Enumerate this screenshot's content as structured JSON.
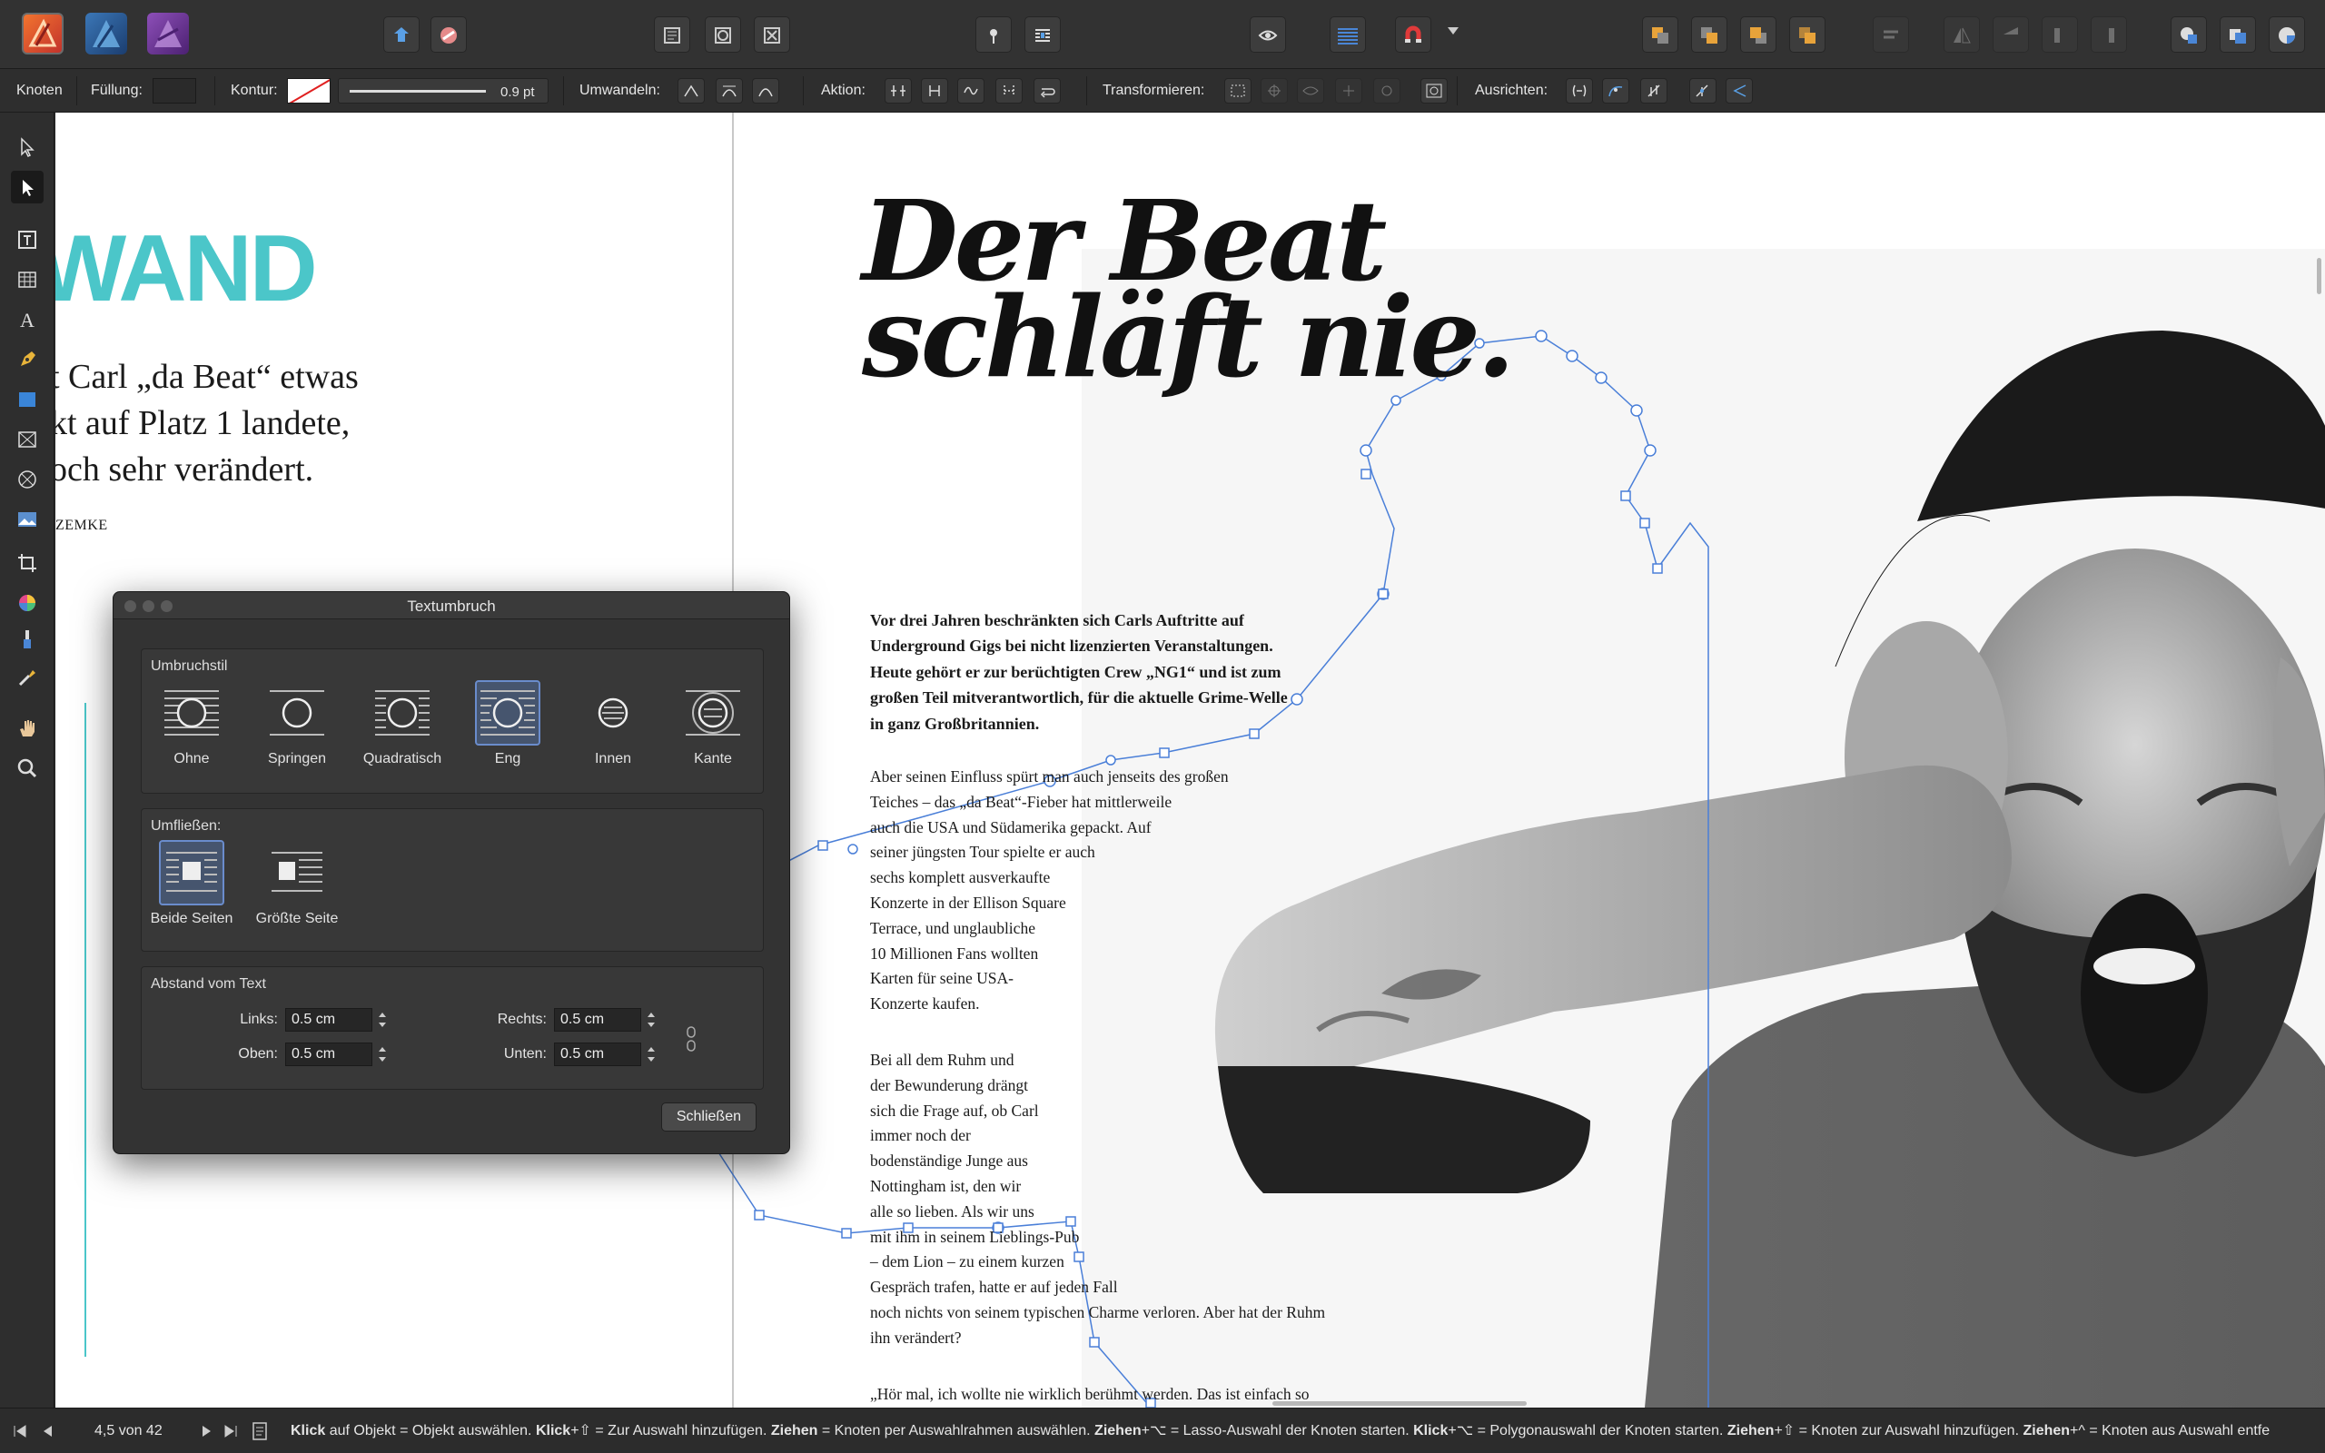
{
  "context_toolbar": {
    "tool_name": "Knoten",
    "fill_label": "Füllung:",
    "stroke_label": "Kontur:",
    "stroke_width": "0.9 pt",
    "convert_label": "Umwandeln:",
    "action_label": "Aktion:",
    "transform_label": "Transformieren:",
    "align_label": "Ausrichten:"
  },
  "colors": {
    "accent": "#4bc6c9",
    "selection": "#4a7fd8"
  },
  "page_left": {
    "heading_fragment": "WAND",
    "intro_lines": [
      "t Carl „da Beat“ etwas",
      "kt auf Platz 1 landete,",
      "och sehr verändert."
    ],
    "byline_fragment": "ZEMKE"
  },
  "page_right": {
    "headline_line1": "Der Beat",
    "headline_line2": "schläft nie.",
    "lead": [
      "Vor drei Jahren beschränkten sich Carls Auftritte auf",
      "Underground Gigs bei nicht lizenzierten Veranstaltungen.",
      "Heute gehört er zur berüchtigten Crew „NG1“ und ist zum",
      "großen Teil mitverantwortlich, für die aktuelle Grime-Welle",
      "in ganz Großbritannien."
    ],
    "para1": [
      "Aber seinen Einfluss spürt man auch jenseits des großen",
      "Teiches – das „da Beat“-Fieber hat mittlerweile",
      "auch die USA und Südamerika gepackt. Auf",
      "seiner jüngsten Tour spielte er auch",
      "sechs komplett ausverkaufte",
      "Konzerte in der Ellison Square",
      "Terrace, und unglaubliche",
      "10 Millionen Fans wollten",
      "Karten für seine USA-",
      "Konzerte kaufen."
    ],
    "para2": [
      "Bei all dem Ruhm und",
      "der Bewunderung drängt",
      "sich die Frage auf, ob Carl",
      "immer noch der",
      "bodenständige Junge aus",
      "Nottingham ist, den wir",
      "alle so lieben. Als wir uns",
      "mit ihm in seinem Lieblings-Pub",
      "– dem Lion – zu einem kurzen",
      "Gespräch trafen, hatte er auf jeden Fall",
      "noch nichts von seinem typischen Charme verloren. Aber hat der Ruhm",
      "ihn verändert?"
    ],
    "para3_first": "„Hör mal, ich wollte nie wirklich berühmt werden. Das ist einfach so"
  },
  "dialog": {
    "title": "Textumbruch",
    "wrap_style_label": "Umbruchstil",
    "wrap_styles": [
      "Ohne",
      "Springen",
      "Quadratisch",
      "Eng",
      "Innen",
      "Kante"
    ],
    "wrap_selected": "Eng",
    "flow_label": "Umfließen:",
    "flow_options": [
      "Beide Seiten",
      "Größte Seite"
    ],
    "flow_selected": "Beide Seiten",
    "distance_label": "Abstand vom Text",
    "left_label": "Links:",
    "left_value": "0.5 cm",
    "top_label": "Oben:",
    "top_value": "0.5 cm",
    "right_label": "Rechts:",
    "right_value": "0.5 cm",
    "bottom_label": "Unten:",
    "bottom_value": "0.5 cm",
    "close_label": "Schließen"
  },
  "status": {
    "page_indicator": "4,5 von 42",
    "hint_parts": [
      {
        "b": "Klick",
        "t": " auf Objekt = Objekt auswählen. "
      },
      {
        "b": "Klick",
        "t": "+⇧ = Zur Auswahl hinzufügen. "
      },
      {
        "b": "Ziehen",
        "t": " = Knoten per Auswahlrahmen auswählen. "
      },
      {
        "b": "Ziehen",
        "t": "+⌥ = Lasso-Auswahl der Knoten starten. "
      },
      {
        "b": "Klick",
        "t": "+⌥ = Polygonauswahl der Knoten starten. "
      },
      {
        "b": "Ziehen",
        "t": "+⇧ = Knoten zur Auswahl hinzufügen. "
      },
      {
        "b": "Ziehen",
        "t": "+^ = Knoten aus Auswahl entfe"
      }
    ]
  }
}
